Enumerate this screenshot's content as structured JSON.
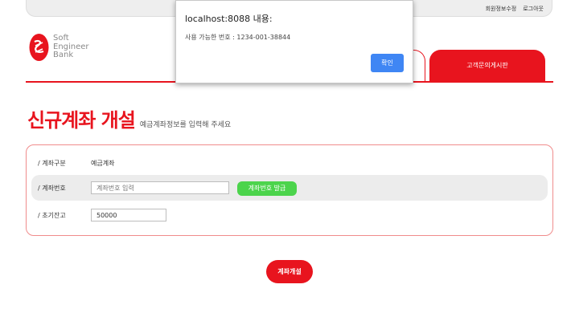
{
  "header": {
    "links": [
      "회원정보수정",
      "로그아웃"
    ]
  },
  "logo": {
    "lines": [
      "Soft",
      "Engineer",
      "Bank"
    ],
    "brand_color": "#e8141e"
  },
  "nav": {
    "tab_active_label": "고객문의게시판",
    "accent": "#e8141e"
  },
  "page": {
    "title": "신규계좌 개설",
    "subtitle": "예금계좌정보를 입력해 주세요"
  },
  "form": {
    "type_label": "/ 계좌구분",
    "type_value": "예금계좌",
    "acct_label": "/ 계좌번호",
    "acct_placeholder": "계좌번호 입력",
    "acct_button": "계좌번호 발급",
    "balance_label": "/ 초기잔고",
    "balance_value": "50000"
  },
  "submit": {
    "label": "계좌개설"
  },
  "dialog": {
    "title": "localhost:8088 내용:",
    "message": "사용 가능한 번호 : 1234-001-38844",
    "ok": "확인"
  }
}
